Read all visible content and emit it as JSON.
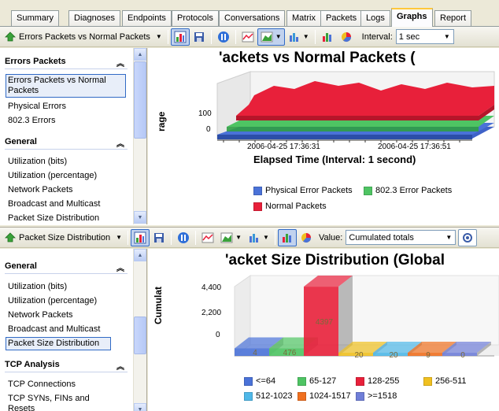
{
  "tabs": [
    "Summary",
    "Diagnoses",
    "Endpoints",
    "Protocols",
    "Conversations",
    "Matrix",
    "Packets",
    "Logs",
    "Graphs",
    "Report"
  ],
  "active_tab": "Graphs",
  "top": {
    "toolbar": {
      "graph_select": "Errors Packets vs Normal Packets",
      "interval_label": "Interval:",
      "interval_value": "1 sec"
    },
    "sidebar": {
      "sections": [
        {
          "title": "Errors Packets",
          "items": [
            "Errors Packets vs Normal Packets",
            "Physical Errors",
            "802.3 Errors"
          ]
        },
        {
          "title": "General",
          "items": [
            "Utilization (bits)",
            "Utilization (percentage)",
            "Network Packets",
            "Broadcast and Multicast",
            "Packet Size Distribution"
          ]
        }
      ],
      "selected": "Errors Packets vs Normal Packets"
    },
    "chart_data": {
      "type": "area",
      "title": "Errors Packets vs Normal Packets (",
      "visible_title": "'ackets vs Normal Packets (",
      "ylabel": "rage",
      "xlabel": "Elapsed Time (Interval: 1 second)",
      "yticks": [
        "0",
        "100"
      ],
      "xticks": [
        "2006-04-25 17:36:31",
        "2006-04-25 17:36:51"
      ],
      "series": [
        {
          "name": "Physical Error Packets",
          "color": "#4a72d8"
        },
        {
          "name": "802.3 Error Packets",
          "color": "#4ec463"
        },
        {
          "name": "Normal Packets",
          "color": "#e8203a"
        }
      ]
    }
  },
  "bottom": {
    "toolbar": {
      "graph_select": "Packet Size Distribution",
      "value_label": "Value:",
      "value_select": "Cumulated totals"
    },
    "sidebar": {
      "sections": [
        {
          "title": "General",
          "items": [
            "Utilization (bits)",
            "Utilization (percentage)",
            "Network Packets",
            "Broadcast and Multicast",
            "Packet Size Distribution"
          ]
        },
        {
          "title": "TCP Analysis",
          "items": [
            "TCP Connections",
            "TCP SYNs, FINs and Resets"
          ]
        }
      ],
      "selected": "Packet Size Distribution"
    },
    "chart_data": {
      "type": "bar",
      "title": "Packet Size Distribution (Global",
      "visible_title": "'acket Size Distribution (Global",
      "ylabel": "Cumulat",
      "yticks": [
        "0",
        "2,200",
        "4,400"
      ],
      "ylim": [
        0,
        4400
      ],
      "categories": [
        "<=64",
        "65-127",
        "128-255",
        "256-511",
        "512-1023",
        "1024-1517",
        ">=1518"
      ],
      "values": [
        476,
        476,
        4397,
        20,
        20,
        9,
        0
      ],
      "labels": [
        "4",
        "476",
        "4397",
        "20",
        "20",
        "9",
        "0"
      ],
      "colors": [
        "#4a72d8",
        "#4ec463",
        "#e8203a",
        "#f0c020",
        "#4fb8e8",
        "#f07020",
        "#6f7ed8"
      ]
    }
  }
}
